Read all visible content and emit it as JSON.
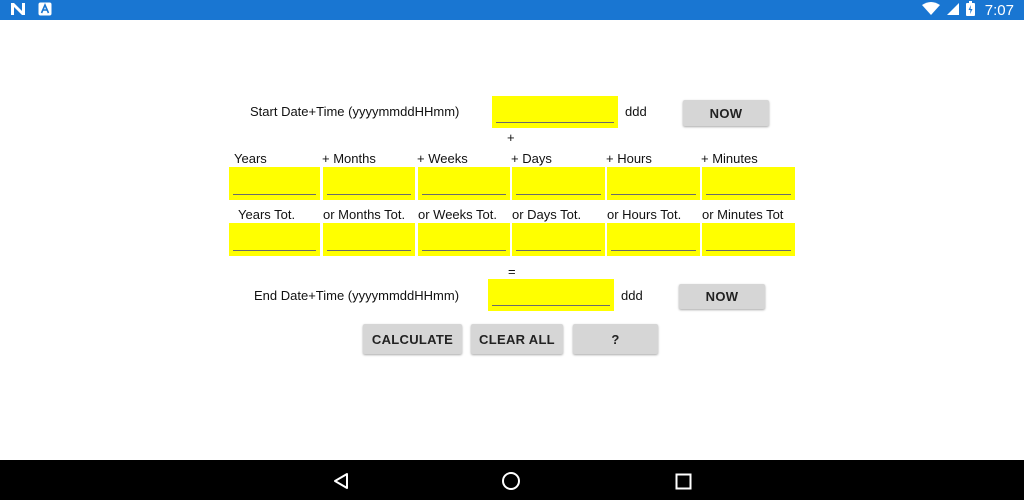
{
  "status_bar": {
    "time": "7:07"
  },
  "start": {
    "label": "Start Date+Time (yyyymmddHHmm)",
    "value": "",
    "day_label": "ddd",
    "now_button": "NOW"
  },
  "plus_sign": "+",
  "equals_sign": "=",
  "increments": [
    {
      "label": "Years",
      "value": ""
    },
    {
      "label": "+ Months",
      "value": ""
    },
    {
      "label": "+ Weeks",
      "value": ""
    },
    {
      "label": "+ Days",
      "value": ""
    },
    {
      "label": "+ Hours",
      "value": ""
    },
    {
      "label": "+ Minutes",
      "value": ""
    }
  ],
  "totals": [
    {
      "label": "Years Tot.",
      "value": ""
    },
    {
      "label": "or Months Tot.",
      "value": ""
    },
    {
      "label": "or Weeks Tot.",
      "value": ""
    },
    {
      "label": "or Days Tot.",
      "value": ""
    },
    {
      "label": "or Hours Tot.",
      "value": ""
    },
    {
      "label": "or Minutes Tot",
      "value": ""
    }
  ],
  "end": {
    "label": "End Date+Time (yyyymmddHHmm)",
    "value": "",
    "day_label": "ddd",
    "now_button": "NOW"
  },
  "actions": {
    "calculate": "CALCULATE",
    "clear_all": "CLEAR ALL",
    "help": "?"
  }
}
